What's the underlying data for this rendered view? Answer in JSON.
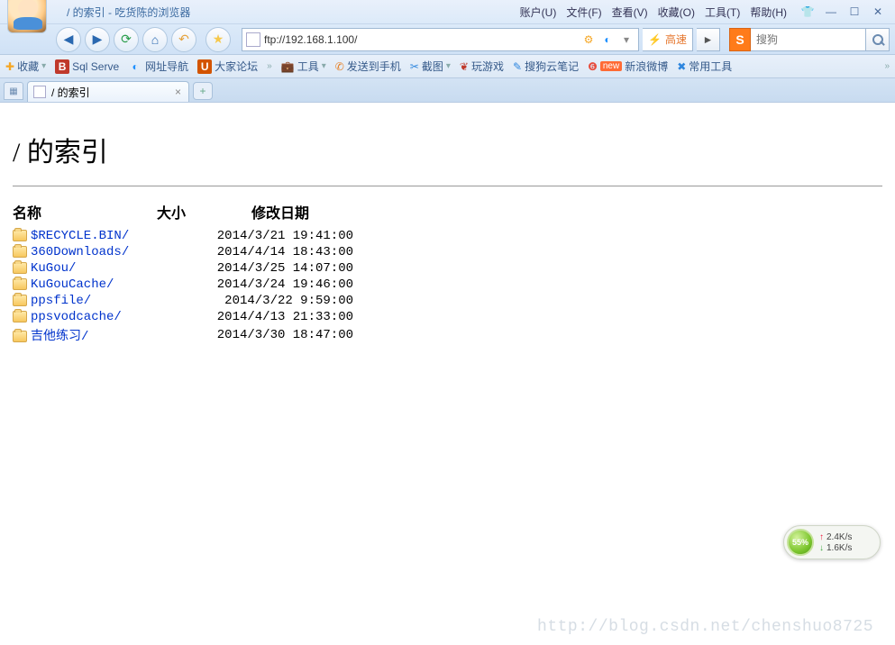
{
  "window": {
    "title": "/ 的索引 - 吃货陈的浏览器"
  },
  "top_menu": [
    {
      "label": "账户(U)"
    },
    {
      "label": "文件(F)"
    },
    {
      "label": "查看(V)"
    },
    {
      "label": "收藏(O)"
    },
    {
      "label": "工具(T)"
    },
    {
      "label": "帮助(H)"
    }
  ],
  "nav": {
    "address": "ftp://192.168.1.100/",
    "speed": "高速"
  },
  "search": {
    "prefix": "S",
    "placeholder": "搜狗"
  },
  "bookmarks": {
    "fav_label": "收藏",
    "items": [
      {
        "label": "Sql Serve",
        "color": "#c0392b",
        "glyph": "B"
      },
      {
        "label": "网址导航",
        "color": "#1e90ff",
        "glyph": "◐"
      },
      {
        "label": "大家论坛",
        "color": "#d35400",
        "glyph": "U"
      }
    ],
    "tools_label": "工具",
    "extra": [
      {
        "label": "发送到手机",
        "color": "#e67e22",
        "glyph": "✆"
      },
      {
        "label": "截图",
        "color": "#2e86de",
        "glyph": "✂"
      },
      {
        "label": "玩游戏",
        "color": "#c0392b",
        "glyph": "❦"
      },
      {
        "label": "搜狗云笔记",
        "color": "#2e86de",
        "glyph": "✎"
      },
      {
        "label": "新浪微博",
        "color": "#e74c3c",
        "glyph": "❻",
        "badge": "new"
      },
      {
        "label": "常用工具",
        "color": "#2e86de",
        "glyph": "✖"
      }
    ]
  },
  "tab": {
    "title": "/ 的索引"
  },
  "page": {
    "heading": "/ 的索引",
    "columns": {
      "name": "名称",
      "size": "大小",
      "date": "修改日期"
    },
    "rows": [
      {
        "name": "$RECYCLE.BIN/",
        "size": "",
        "date": "2014/3/21 19:41:00"
      },
      {
        "name": "360Downloads/",
        "size": "",
        "date": "2014/4/14 18:43:00"
      },
      {
        "name": "KuGou/",
        "size": "",
        "date": "2014/3/25 14:07:00"
      },
      {
        "name": "KuGouCache/",
        "size": "",
        "date": "2014/3/24 19:46:00"
      },
      {
        "name": "ppsfile/",
        "size": "",
        "date": "2014/3/22 9:59:00"
      },
      {
        "name": "ppsvodcache/",
        "size": "",
        "date": "2014/4/13 21:33:00"
      },
      {
        "name": "吉他练习/",
        "size": "",
        "date": "2014/3/30 18:47:00"
      }
    ]
  },
  "netmon": {
    "pct": "55%",
    "up": "2.4K/s",
    "down": "1.6K/s"
  },
  "watermark": "http://blog.csdn.net/chenshuo8725"
}
